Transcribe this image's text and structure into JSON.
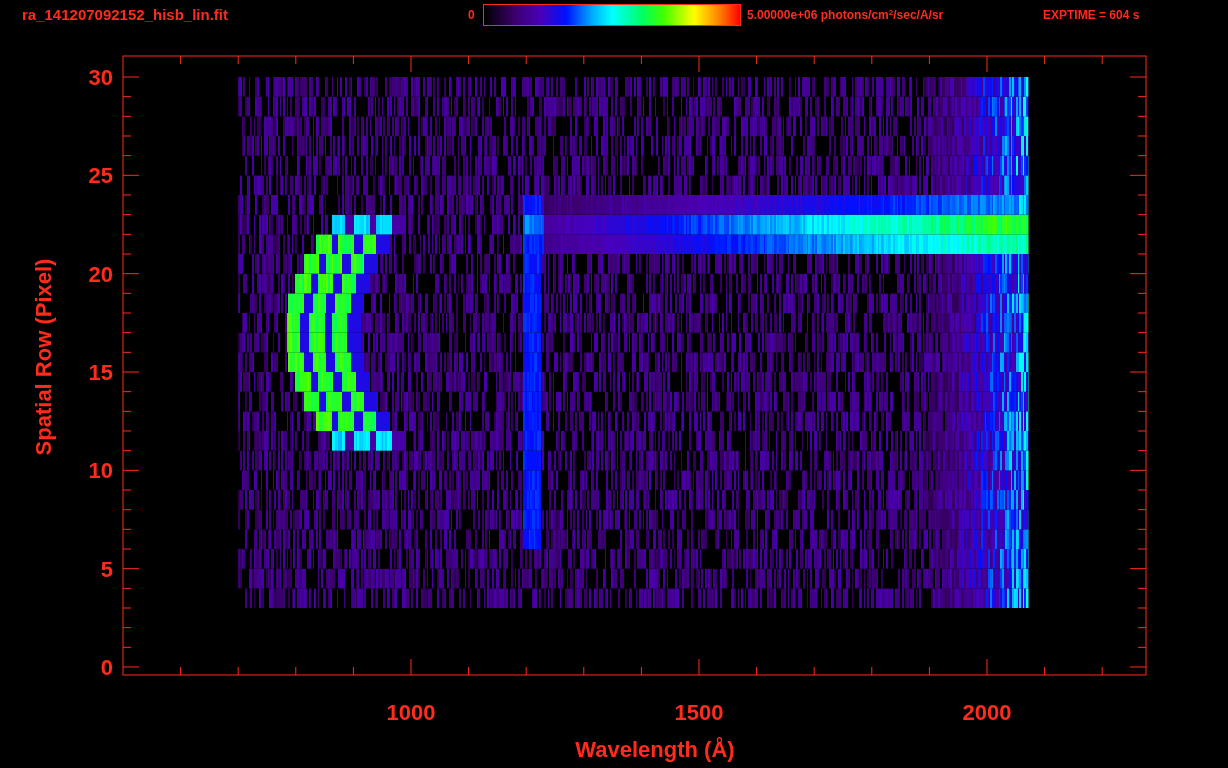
{
  "header": {
    "filename": "ra_141207092152_hisb_lin.fit",
    "colorbar_min": "0",
    "colorbar_max": "5.00000e+06 photons/cm$^{2}$/sec/A/sr",
    "exptime": "EXPTIME = 604 s"
  },
  "plot": {
    "xlabel": "Wavelength (Å)",
    "ylabel": "Spatial Row (Pixel)",
    "xtick_labels": [
      "1000",
      "1500",
      "2000"
    ],
    "ytick_labels": [
      "30",
      "25",
      "20",
      "15",
      "10",
      "5",
      "0"
    ]
  }
}
